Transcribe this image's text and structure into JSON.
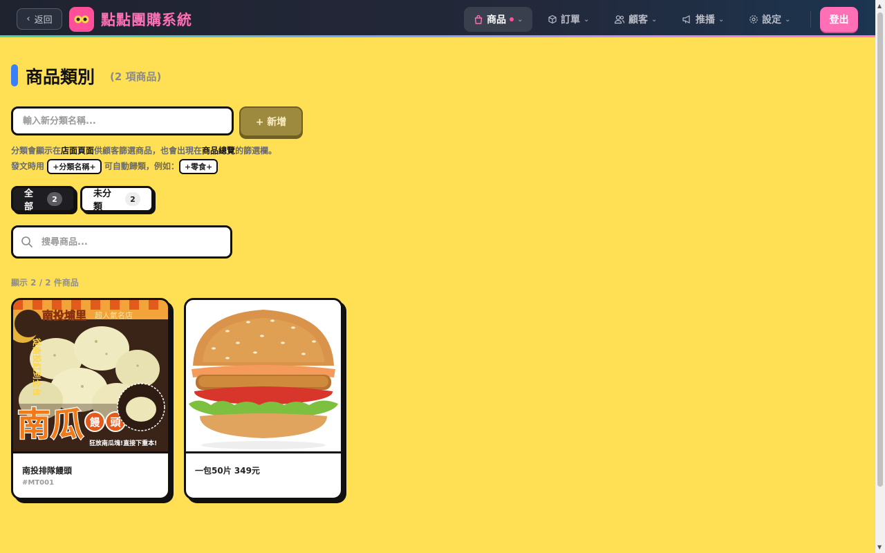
{
  "header": {
    "back_label": "返回",
    "app_title": "點點團購系統",
    "nav": [
      {
        "label": "商品"
      },
      {
        "label": "訂單"
      },
      {
        "label": "顧客"
      },
      {
        "label": "推播"
      },
      {
        "label": "設定"
      }
    ],
    "logout_label": "登出"
  },
  "page": {
    "title": "商品類別",
    "count_label": "(2 項商品)"
  },
  "new_category": {
    "placeholder": "輸入新分類名稱...",
    "add_label": "+ 新增"
  },
  "hint": {
    "l1_a": "分類會顯示在",
    "l1_b": "店面頁面",
    "l1_c": "供顧客篩選商品，也會出現在",
    "l1_d": "商品總覽",
    "l1_e": "的篩選欄。",
    "l2_a": "發文時用",
    "chip1": "+分類名稱+",
    "l2_b": "可自動歸類，例如：",
    "chip2": "+零食+"
  },
  "filters": [
    {
      "label": "全部",
      "count": "2"
    },
    {
      "label": "未分類",
      "count": "2"
    }
  ],
  "search": {
    "placeholder": "搜尋商品..."
  },
  "showing_label": "顯示 2 / 2 件商品",
  "products": [
    {
      "name": "南投排隊饅頭",
      "sku": "#MT001",
      "image_text": {
        "banner": "南投埔里",
        "banner_sub": "超人氣名店",
        "vertical": "從南投紅到全台",
        "big": "南瓜",
        "circle1": "饅",
        "circle2": "頭",
        "tagline": "狂放南瓜塊!直接下重本!"
      }
    },
    {
      "name": "一包50片 349元",
      "sku": ""
    }
  ],
  "colors": {
    "page_bg": "#FFE055",
    "topbar_bg": "#1f2330",
    "brand_pink": "#ff6fb5",
    "accent_blue": "#3b7ff6"
  }
}
